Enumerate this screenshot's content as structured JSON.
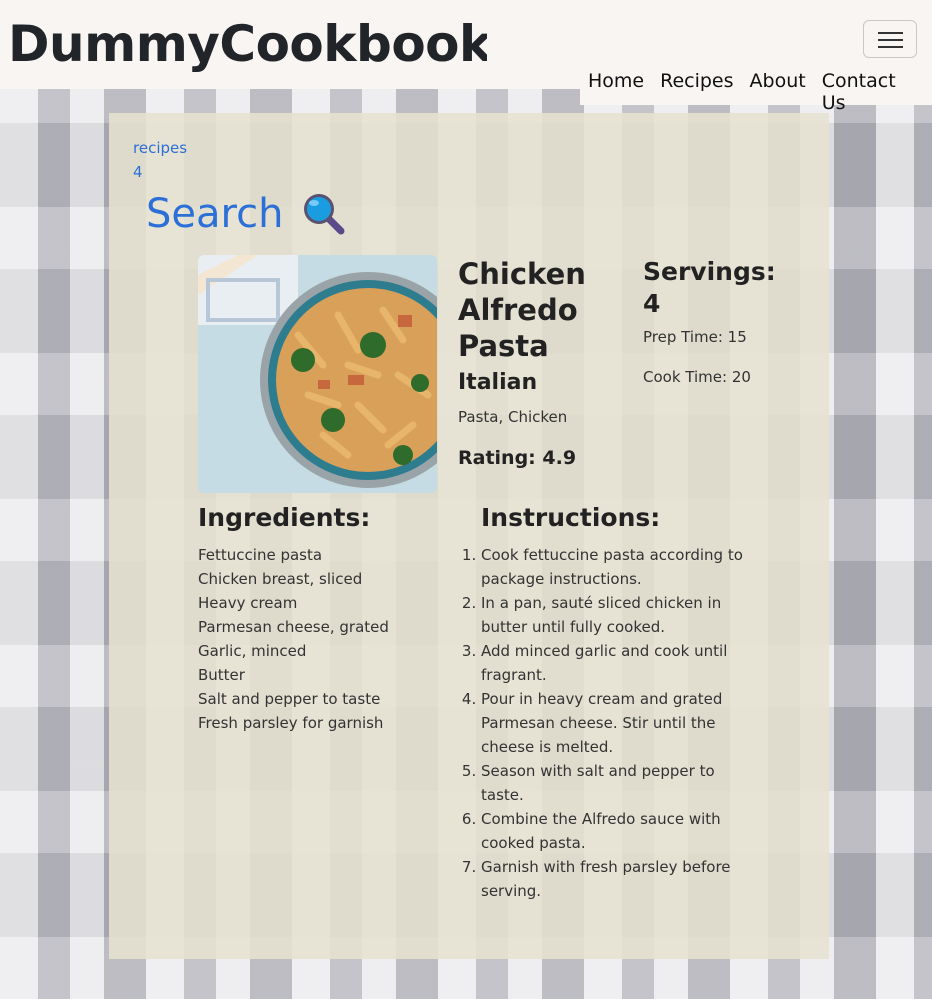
{
  "navbar": {
    "brand": "DummyCookbook",
    "links": [
      "Home",
      "Recipes",
      "About",
      "Contact Us"
    ]
  },
  "breadcrumb": {
    "recipes_link": "recipes",
    "id_link": "4"
  },
  "search": {
    "label": "Search"
  },
  "recipe": {
    "name": "Chicken Alfredo Pasta",
    "cuisine": "Italian",
    "tags": "Pasta, Chicken",
    "rating": "Rating: 4.9",
    "servings": "Servings: 4",
    "prep_time": "Prep Time: 15",
    "cook_time": "Cook Time: 20",
    "ingredients_heading": "Ingredients:",
    "ingredients": [
      "Fettuccine pasta",
      "Chicken breast, sliced",
      "Heavy cream",
      "Parmesan cheese, grated",
      "Garlic, minced",
      "Butter",
      "Salt and pepper to taste",
      "Fresh parsley for garnish"
    ],
    "instructions_heading": "Instructions:",
    "instructions": [
      "Cook fettuccine pasta according to package instructions.",
      "In a pan, sauté sliced chicken in butter until fully cooked.",
      "Add minced garlic and cook until fragrant.",
      "Pour in heavy cream and grated Parmesan cheese. Stir until the cheese is melted.",
      "Season with salt and pepper to taste.",
      "Combine the Alfredo sauce with cooked pasta.",
      "Garnish with fresh parsley before serving."
    ]
  },
  "colors": {
    "link": "#2c6fd6",
    "navbar_bg": "#f8f5f3",
    "panel_bg": "#e6e2d2"
  },
  "icons": {
    "search": "magnifying-glass-icon",
    "menu": "hamburger-menu-icon"
  }
}
